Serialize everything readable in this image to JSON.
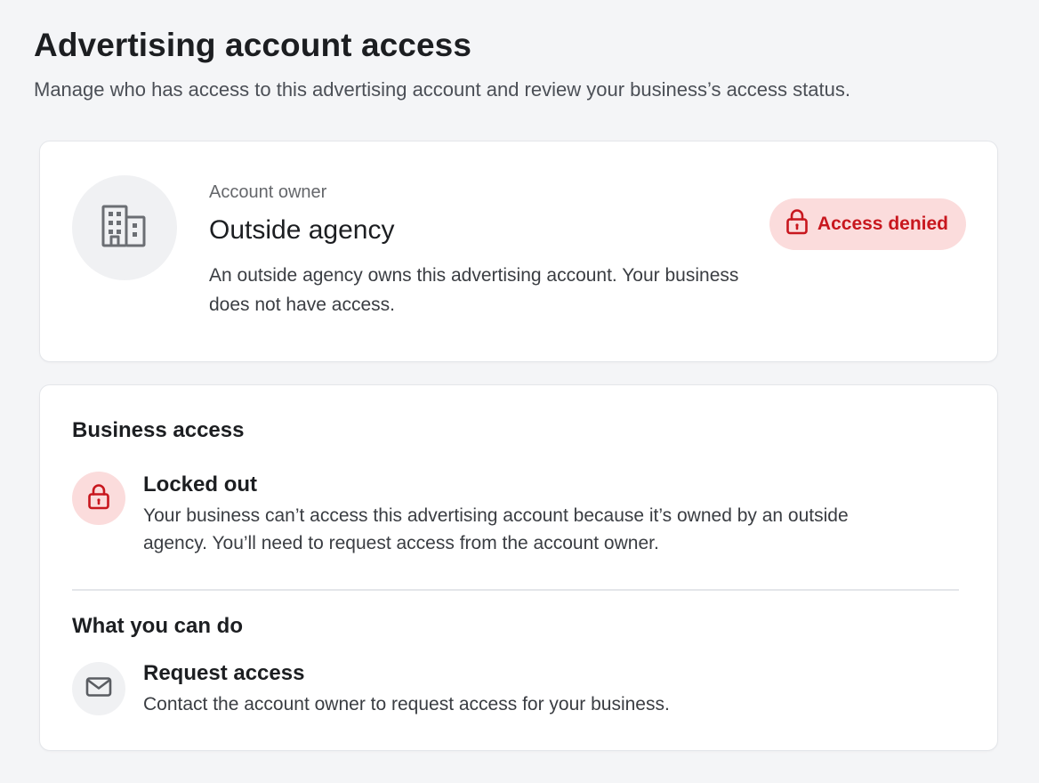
{
  "page": {
    "title": "Advertising account access",
    "subtitle": "Manage who has access to this advertising account and review your business’s access status."
  },
  "owner_card": {
    "avatar_icon": "building-icon",
    "label": "Account owner",
    "name": "Outside agency",
    "description": "An outside agency owns this advertising account. Your business does not have access.",
    "status": {
      "icon": "lock-icon",
      "label": "Access denied",
      "color": "#c8171e",
      "background": "#fbdcdc"
    }
  },
  "access_card": {
    "business_access": {
      "heading": "Business access",
      "status_icon": "lock-icon",
      "status_title": "Locked out",
      "status_description": "Your business can’t access this advertising account because it’s owned by an outside agency. You’ll need to request access from the account owner."
    },
    "actions": {
      "heading": "What you can do",
      "items": [
        {
          "icon": "envelope-icon",
          "title": "Request access",
          "description": "Contact the account owner to request access for your business."
        }
      ]
    }
  },
  "colors": {
    "background": "#f4f5f7",
    "card": "#ffffff",
    "danger": "#c8171e",
    "danger_soft": "#fbdcdc",
    "text_primary": "#1c1e21",
    "text_secondary": "#65676b"
  }
}
